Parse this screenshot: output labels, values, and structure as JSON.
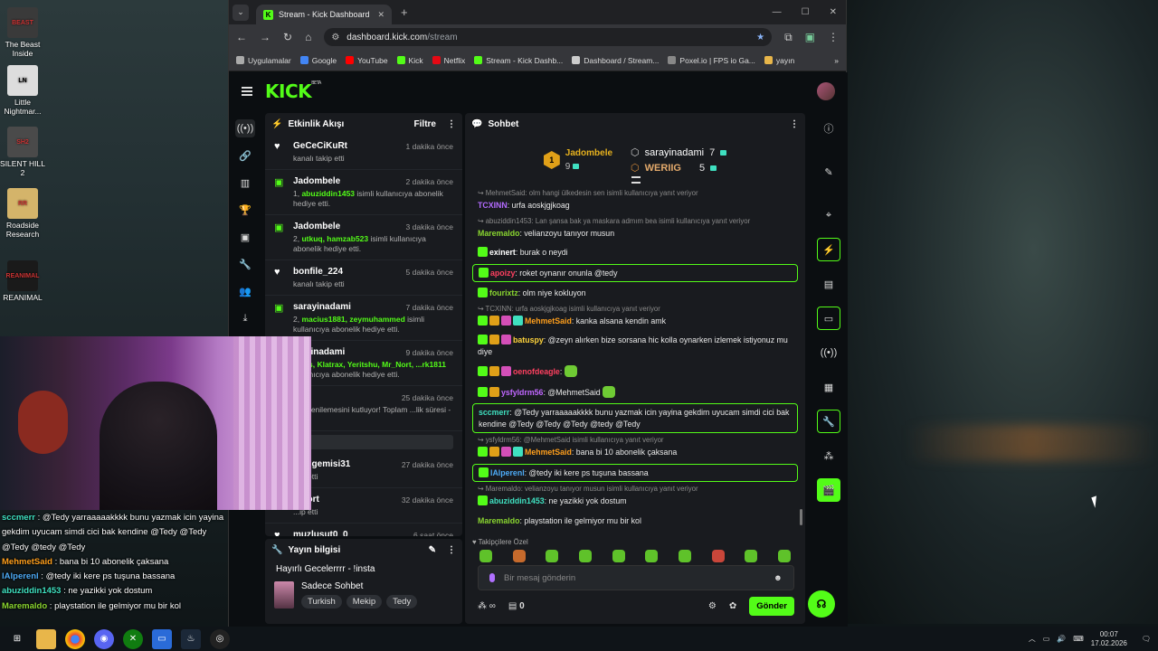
{
  "desktop": {
    "icons": [
      {
        "label": "The Beast Inside",
        "art": "BEAST"
      },
      {
        "label": "Little Nightmar...",
        "art": "LN"
      },
      {
        "label": "SILENT HILL 2",
        "art": "SH2"
      },
      {
        "label": "Roadside Research",
        "art": "RR"
      },
      {
        "label": "REANIMAL",
        "art": "REANIMAL"
      }
    ]
  },
  "browser": {
    "tab_title": "Stream - Kick Dashboard",
    "url_host": "dashboard.kick.com",
    "url_path": "/stream",
    "bookmarks": [
      "Uygulamalar",
      "Google",
      "YouTube",
      "Kick",
      "Netflix",
      "Stream - Kick Dashb...",
      "Dashboard / Stream...",
      "Poxel.io | FPS io Ga...",
      "yayın"
    ]
  },
  "kick": {
    "logo": "KICK",
    "logo_beta": "BETA",
    "activity": {
      "title": "Etkinlik Akışı",
      "filter": "Filtre",
      "events": [
        {
          "icon": "heart-icon",
          "name": "GeCeCiKuRt",
          "time": "1 dakika önce",
          "pre": "",
          "highlight": "",
          "post": "kanalı takip etti"
        },
        {
          "icon": "gift-icon",
          "name": "Jadombele",
          "time": "2 dakika önce",
          "pre": "1, ",
          "highlight": "abuziddin1453",
          "post": " isimli kullanıcıya abonelik hediye etti."
        },
        {
          "icon": "gift-icon",
          "name": "Jadombele",
          "time": "3 dakika önce",
          "pre": "2, ",
          "highlight": "utkuq, hamzab523",
          "post": " isimli kullanıcıya abonelik hediye etti."
        },
        {
          "icon": "heart-icon",
          "name": "bonfile_224",
          "time": "5 dakika önce",
          "pre": "",
          "highlight": "",
          "post": "kanalı takip etti"
        },
        {
          "icon": "gift-icon",
          "name": "sarayinadami",
          "time": "7 dakika önce",
          "pre": "2, ",
          "highlight": "macius1881, zeymuhammed",
          "post": " isimli kullanıcıya abonelik hediye etti."
        },
        {
          "icon": "gift-icon",
          "name": "...ayinadami",
          "time": "9 dakika önce",
          "pre": "",
          "highlight": "...has, Klatrax, Yeritshu, Mr_Nort, ...rk1811",
          "post": " kullanıcıya abonelik hediye etti."
        },
        {
          "icon": "star-icon",
          "name": "...t1",
          "time": "25 dakika önce",
          "pre": "",
          "highlight": "",
          "post": "...ik yenilemesini kutluyor! Toplam ...lik süresi - 2 ay!"
        },
        {
          "icon": "heart-icon",
          "name": "...ungemisi31",
          "time": "27 dakika önce",
          "pre": "",
          "highlight": "",
          "post": "...ip etti"
        },
        {
          "icon": "heart-icon",
          "name": "...Nort",
          "time": "32 dakika önce",
          "pre": "",
          "highlight": "",
          "post": "...ip etti"
        },
        {
          "icon": "heart-icon",
          "name": "muzlusut0_0",
          "time": "6 saat önce",
          "pre": "",
          "highlight": "",
          "post": ""
        }
      ]
    },
    "stream_info": {
      "title": "Yayın bilgisi",
      "stream_title": "Hayırlı Gecelerrrr - !insta",
      "category": "Sadece Sohbet",
      "tags": [
        "Turkish",
        "Mekip",
        "Tedy"
      ]
    },
    "chat": {
      "title": "Sohbet",
      "leaderboard": {
        "first_rank": "1",
        "first_name": "Jadombele",
        "first_count": "9",
        "second_name": "sarayinadami",
        "second_count": "7",
        "third_name": "WERIIG",
        "third_count": "5"
      },
      "messages": [
        {
          "reply": "↪ MehmetSaid: olm hangi ülkedesin sen isimli kullanıcıya yanıt veriyor",
          "user": "TCXINN",
          "color": "#b36bff",
          "text": ": urfa aoskjgjkoag",
          "hl": false,
          "badges": 0
        },
        {
          "reply": "↪ abuziddin1453: Lan şansa bak ya maskara admım bea isimli kullanıcıya yanıt veriyor",
          "user": "Maremaldo",
          "color": "#8ad630",
          "text": ": velianzoyu tanıyor musun",
          "hl": false,
          "badges": 0
        },
        {
          "reply": "",
          "user": "exinert",
          "color": "#ffffff",
          "text": ": burak o neydi",
          "hl": false,
          "badges": 1
        },
        {
          "reply": "",
          "user": "apoizy",
          "color": "#ff4060",
          "text": ": roket oynanır onunla @tedy",
          "hl": true,
          "badges": 1
        },
        {
          "reply": "",
          "user": "fourixtz",
          "color": "#8ad630",
          "text": ": olm niye kokluyon",
          "hl": false,
          "badges": 1
        },
        {
          "reply": "↪ TCXINN: urfa aoskjgjkoag isimli kullanıcıya yanıt veriyor",
          "user": "MehmetSaid",
          "color": "#ff9f1c",
          "text": ": kanka alsana kendin amk",
          "hl": false,
          "badges": 4
        },
        {
          "reply": "",
          "user": "batuspy",
          "color": "#ffd43b",
          "text": ": @zeyn alırken bize sorsana hic kolla oynarken izlemek istiyonuz mu diye",
          "hl": false,
          "badges": 3
        },
        {
          "reply": "",
          "user": "oenofdeagle",
          "color": "#ff4060",
          "text": ":",
          "hl": false,
          "badges": 3
        },
        {
          "reply": "",
          "user": "ysfyldrm56",
          "color": "#c067ff",
          "text": ": @MehmetSaid",
          "hl": false,
          "badges": 2
        },
        {
          "reply": "",
          "user": "sccmerr",
          "color": "#3fe0c0",
          "text": ": @Tedy yarraaaaakkkk bunu yazmak icin yayina gekdim uyucam simdi cici bak kendine @Tedy @Tedy @Tedy @tedy @Tedy",
          "hl": true,
          "badges": 0
        },
        {
          "reply": "↪ ysfyldrm56: @MehmetSaid isimli kullanıcıya yanıt veriyor",
          "user": "MehmetSaid",
          "color": "#ff9f1c",
          "text": ": bana bi 10 abonelik çaksana",
          "hl": false,
          "badges": 4
        },
        {
          "reply": "",
          "user": "lAlperenl",
          "color": "#4dabf7",
          "text": ": @tedy iki kere ps tuşuna bassana",
          "hl": true,
          "badges": 1
        },
        {
          "reply": "↪ Maremaldo: velianzoyu tanıyor musun isimli kullanıcıya yanıt veriyor",
          "user": "abuziddin1453",
          "color": "#3fe0c0",
          "text": ": ne yazikki yok dostum",
          "hl": false,
          "badges": 1
        },
        {
          "reply": "",
          "user": "Maremaldo",
          "color": "#8ad630",
          "text": ": playstation ile gelmiyor mu bir kol",
          "hl": false,
          "badges": 0
        }
      ],
      "emote_section": "♥ Takipçilere Özel",
      "placeholder": "Bir mesaj gönderin",
      "infinity": "∞",
      "vault_count": "0",
      "send": "Gönder"
    }
  },
  "overlay_chat": [
    {
      "user": "sccmerr",
      "color": "#3fe0c0",
      "text": " : @Tedy yarraaaaakkkk bunu yazmak icin yayina gekdim uyucam simdi cici bak kendine @Tedy @Tedy @Tedy @tedy @Tedy"
    },
    {
      "user": "MehmetSaid",
      "color": "#ff9f1c",
      "text": " : bana bi 10 abonelik çaksana"
    },
    {
      "user": "lAlperenl",
      "color": "#4dabf7",
      "text": " : @tedy iki kere ps tuşuna bassana"
    },
    {
      "user": "abuziddin1453",
      "color": "#3fe0c0",
      "text": " : ne yazikki yok dostum"
    },
    {
      "user": "Maremaldo",
      "color": "#8ad630",
      "text": " : playstation ile gelmiyor mu bir kol"
    }
  ],
  "taskbar": {
    "time": "00:07",
    "date": "17.02.2026"
  },
  "colors": {
    "kick_green": "#53fc18",
    "panel": "#191b1f",
    "bg": "#0b0e11"
  }
}
